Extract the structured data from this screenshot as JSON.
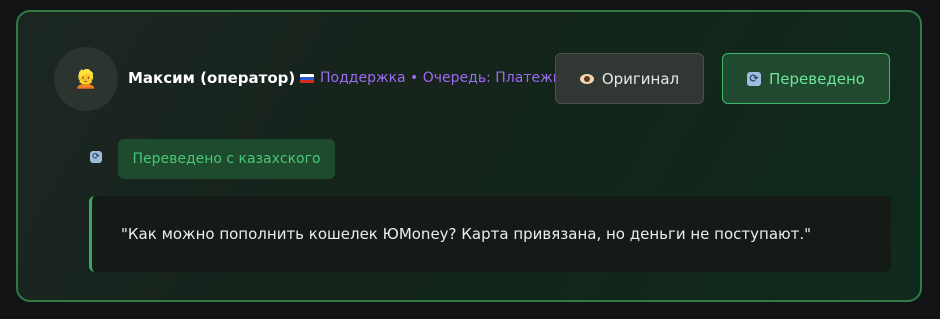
{
  "header": {
    "avatar_icon": "person-icon",
    "avatar_glyph": "👱",
    "operator_name": "Максим (оператор)",
    "queue_flag": "russia-flag-icon",
    "queue_text": "Поддержка • Очередь: Платежи"
  },
  "view_toggle": {
    "original_label": "Оригинал",
    "original_icon": "eye-icon",
    "translated_label": "Переведено",
    "translated_icon": "refresh-icon",
    "active": "translated"
  },
  "translation": {
    "icon": "refresh-icon",
    "badge_text": "Переведено с казахского"
  },
  "message": {
    "text": "\"Как можно пополнить кошелек ЮMoney? Карта привязана, но деньги не поступают.\""
  },
  "colors": {
    "accent_green": "#3fb768",
    "queue_purple": "#9b6bf2",
    "card_border": "#2f7a47"
  }
}
